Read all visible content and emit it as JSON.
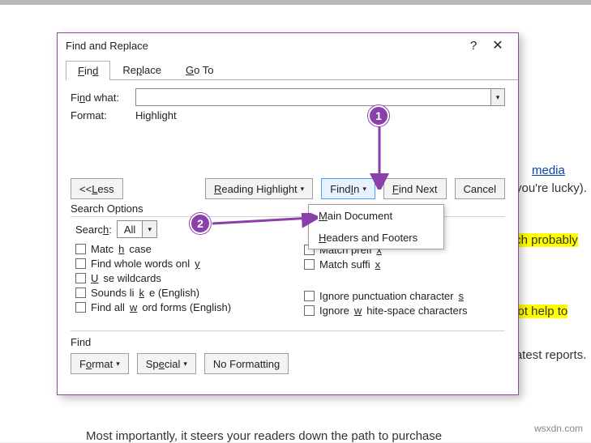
{
  "dialog": {
    "title": "Find and Replace",
    "help": "?",
    "close": "✕",
    "tabs": {
      "find": "Find",
      "replace": "Replace",
      "goto": "Go To"
    },
    "findWhatLabel": "Find what:",
    "findWhatValue": "",
    "formatLabel": "Format:",
    "formatValue": "Highlight",
    "buttons": {
      "less": "<< Less",
      "readingHighlight": "Reading Highlight",
      "findIn": "Find In",
      "findNext": "Find Next",
      "cancel": "Cancel"
    },
    "findInMenu": {
      "main": "Main Document",
      "headers": "Headers and Footers"
    },
    "searchOptionsTitle": "Search Options",
    "searchLabel": "Search:",
    "searchValue": "All",
    "leftChecks": {
      "matchCase": "Match case",
      "wholeWords": "Find whole words only",
      "wildcards": "Use wildcards",
      "soundsLike": "Sounds like (English)",
      "allForms": "Find all word forms (English)"
    },
    "rightChecks": {
      "prefix": "Match prefix",
      "suffix": "Match suffix",
      "punct": "Ignore punctuation characters",
      "space": "Ignore white-space characters"
    },
    "findTitle": "Find",
    "bottomButtons": {
      "format": "Format",
      "special": "Special",
      "noFormatting": "No Formatting"
    }
  },
  "callouts": {
    "one": "1",
    "two": "2"
  },
  "background": {
    "link": "media",
    "afterLink": " you're lucky).",
    "frag1": "vhich probably",
    "frag2": "ill not help to",
    "frag3": "e latest reports.",
    "bottom": "Most importantly, it steers your readers down the path to purchase",
    "watermark": "wsxdn.com"
  }
}
